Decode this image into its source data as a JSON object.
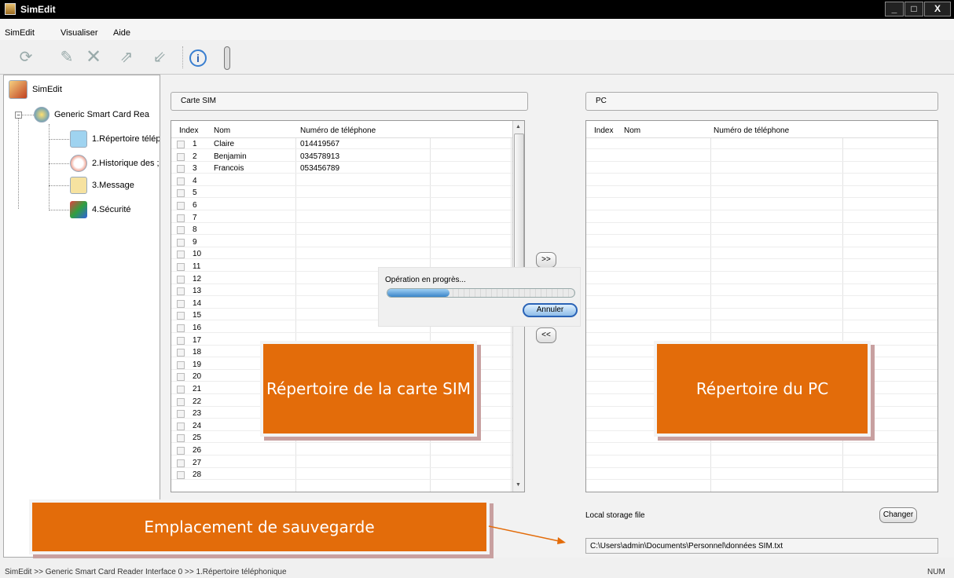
{
  "window": {
    "title": "SimEdit",
    "min_label": "_",
    "max_label": "□",
    "close_label": "X"
  },
  "menu": [
    "SimEdit",
    "Visualiser",
    "Aide"
  ],
  "toolbar": [
    "refresh-icon",
    "edit-icon",
    "delete-icon",
    "sim-to-pc-icon",
    "pc-to-sim-icon",
    "info-icon",
    "usb-icon"
  ],
  "tree": {
    "root": "SimEdit",
    "reader": "Generic Smart Card Rea",
    "items": [
      {
        "label": "1.Répertoire télép",
        "icon": "phonebook-icon"
      },
      {
        "label": "2.Historique des ;",
        "icon": "call-history-icon"
      },
      {
        "label": "3.Message",
        "icon": "message-icon"
      },
      {
        "label": "4.Sécurité",
        "icon": "security-icon"
      }
    ]
  },
  "sim": {
    "title": "Carte SIM",
    "headers": [
      "Index",
      "Nom",
      "Numéro de téléphone"
    ],
    "rows": [
      [
        "1",
        "Claire",
        "014419567"
      ],
      [
        "2",
        "Benjamin",
        "034578913"
      ],
      [
        "3",
        "Francois",
        "053456789"
      ],
      [
        "4",
        "",
        ""
      ],
      [
        "5",
        "",
        ""
      ],
      [
        "6",
        "",
        ""
      ],
      [
        "7",
        "",
        ""
      ],
      [
        "8",
        "",
        ""
      ],
      [
        "9",
        "",
        ""
      ],
      [
        "10",
        "",
        ""
      ],
      [
        "11",
        "",
        ""
      ],
      [
        "12",
        "",
        ""
      ],
      [
        "13",
        "",
        ""
      ],
      [
        "14",
        "",
        ""
      ],
      [
        "15",
        "",
        ""
      ],
      [
        "16",
        "",
        ""
      ],
      [
        "17",
        "",
        ""
      ],
      [
        "18",
        "",
        ""
      ],
      [
        "19",
        "",
        ""
      ],
      [
        "20",
        "",
        ""
      ],
      [
        "21",
        "",
        ""
      ],
      [
        "22",
        "",
        ""
      ],
      [
        "23",
        "",
        ""
      ],
      [
        "24",
        "",
        ""
      ],
      [
        "25",
        "",
        ""
      ],
      [
        "26",
        "",
        ""
      ],
      [
        "27",
        "",
        ""
      ],
      [
        "28",
        "",
        ""
      ]
    ]
  },
  "pc": {
    "title": "PC",
    "headers": [
      "Index",
      "Nom",
      "Numéro de téléphone"
    ]
  },
  "buttons": {
    "to_pc": ">>",
    "to_sim": "<<",
    "change": "Changer"
  },
  "progress": {
    "label": "Opération en progrès...",
    "cancel": "Annuler",
    "value": 0.33
  },
  "storage": {
    "label": "Local storage file",
    "path": "C:\\Users\\admin\\Documents\\Personnel\\données SIM.txt"
  },
  "callouts": {
    "sim": "Répertoire de la carte SIM",
    "pc": "Répertoire du PC",
    "save": "Emplacement de sauvegarde"
  },
  "status": {
    "path": "SimEdit  >>  Generic Smart Card Reader Interface 0  >>  1.Répertoire téléphonique",
    "num": "NUM"
  }
}
